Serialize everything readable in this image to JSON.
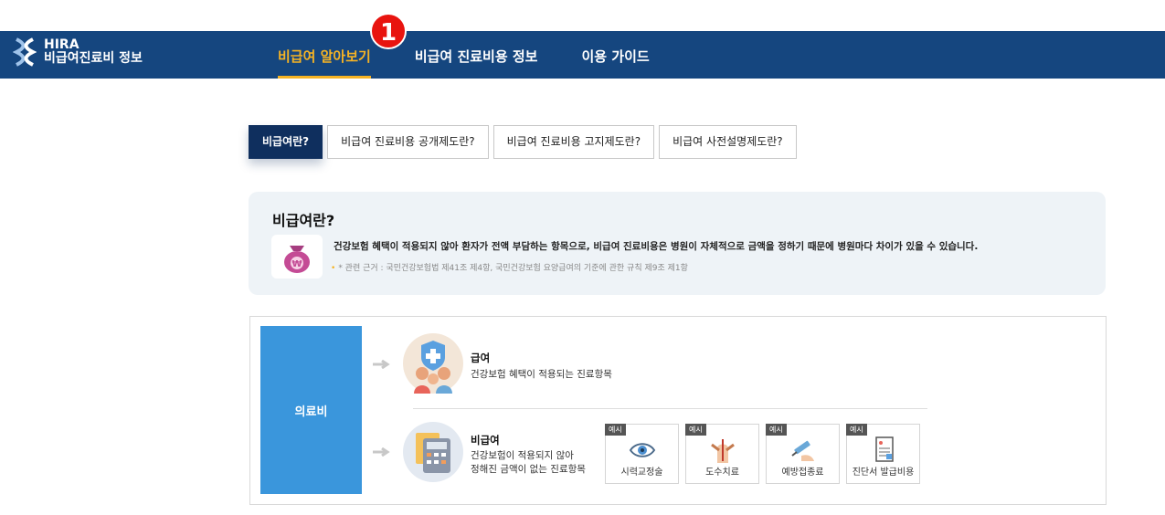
{
  "header": {
    "logo_line1": "HIRA",
    "logo_line2": "비급여진료비 정보",
    "nav": [
      {
        "label": "비급여 알아보기",
        "active": true
      },
      {
        "label": "비급여 진료비용 정보",
        "active": false
      },
      {
        "label": "이용 가이드",
        "active": false
      }
    ],
    "badge": "1"
  },
  "tabs": [
    {
      "label": "비급여란?",
      "active": true
    },
    {
      "label": "비급여 진료비용 공개제도란?",
      "active": false
    },
    {
      "label": "비급여 진료비용 고지제도란?",
      "active": false
    },
    {
      "label": "비급여 사전설명제도란?",
      "active": false
    }
  ],
  "info": {
    "title": "비급여란?",
    "description": "건강보험 혜택이 적용되지 않아 환자가 전액 부담하는 항목으로, 비급여 진료비용은 병원이 자체적으로 금액을 정하기 때문에 병원마다 차이가 있을 수 있습니다.",
    "note": "* 관련 근거 : 국민건강보험법 제41조 제4항, 국민건강보험 요양급여의 기준에 관한 규칙 제9조 제1항"
  },
  "diagram": {
    "root": "의료비",
    "covered": {
      "title": "급여",
      "desc": "건강보험 혜택이 적용되는 진료항목"
    },
    "noncovered": {
      "title": "비급여",
      "desc_line1": "건강보험이 적용되지 않아",
      "desc_line2": "정해진 금액이 없는 진료항목"
    },
    "example_tag": "예시",
    "examples": [
      {
        "label": "시력교정술",
        "icon": "eye-icon"
      },
      {
        "label": "도수치료",
        "icon": "manual-therapy-icon"
      },
      {
        "label": "예방접종료",
        "icon": "syringe-icon"
      },
      {
        "label": "진단서 발급비용",
        "icon": "certificate-icon"
      }
    ]
  },
  "colors": {
    "header_bg": "#15467f",
    "accent": "#f5b324",
    "active_tab": "#0f2f5e",
    "medfee_box": "#3a96dc",
    "badge": "#e8140f"
  }
}
